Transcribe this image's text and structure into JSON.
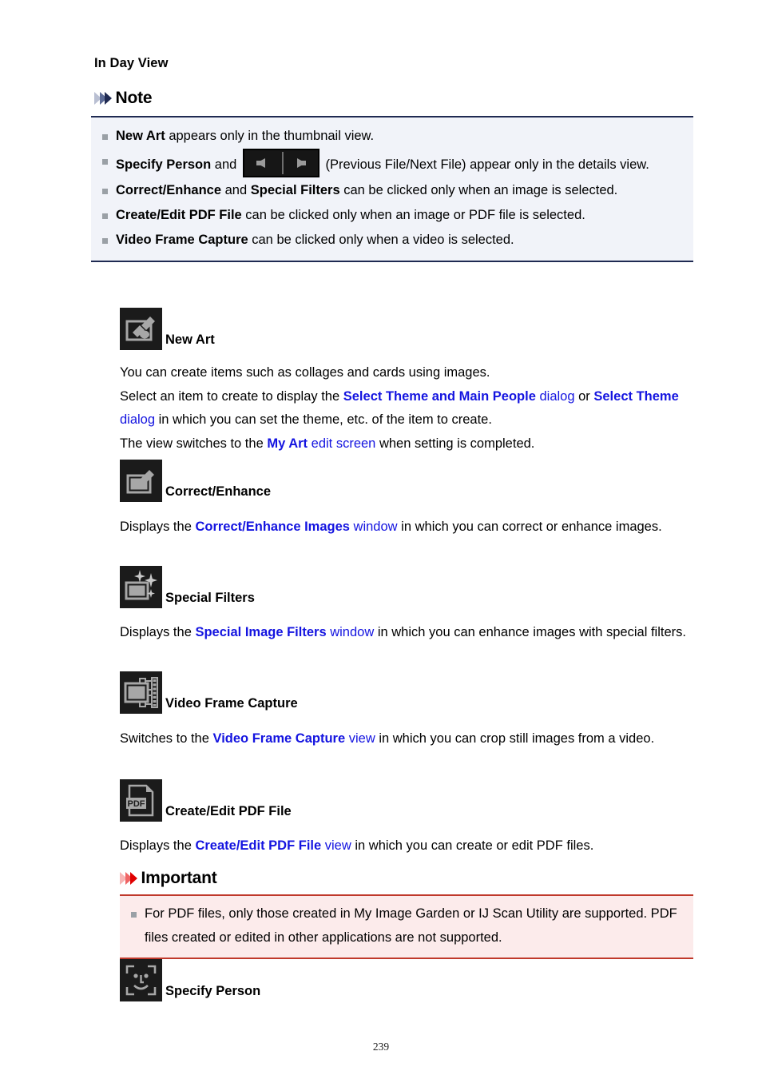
{
  "page": {
    "section_title": "In Day View",
    "page_number": "239"
  },
  "note": {
    "header_label": "Note",
    "accent_color": "#1f2a52",
    "background_color": "#f1f3f9",
    "bullets": [
      {
        "id": "new-art-note",
        "parts": [
          {
            "text": "New Art",
            "style": "bold"
          },
          {
            "text": " appears only in the thumbnail view.",
            "style": "normal"
          }
        ]
      },
      {
        "id": "specify-person-note",
        "parts": [
          {
            "text": "Specify Person",
            "style": "bold"
          },
          {
            "text": " and ",
            "style": "normal"
          },
          {
            "text": "",
            "style": "icon-prev-next"
          },
          {
            "text": " (Previous File/Next File) appear only in the details view.",
            "style": "normal"
          }
        ]
      },
      {
        "id": "correct-enhance-note",
        "parts": [
          {
            "text": "Correct/Enhance",
            "style": "bold"
          },
          {
            "text": " and ",
            "style": "normal"
          },
          {
            "text": "Special Filters",
            "style": "bold"
          },
          {
            "text": " can be clicked only when an image is selected.",
            "style": "normal"
          }
        ]
      },
      {
        "id": "create-edit-pdf-note",
        "parts": [
          {
            "text": "Create/Edit PDF File",
            "style": "bold"
          },
          {
            "text": " can be clicked only when an image or PDF file is selected.",
            "style": "normal"
          }
        ]
      },
      {
        "id": "video-frame-capture-note",
        "parts": [
          {
            "text": "Video Frame Capture",
            "style": "bold"
          },
          {
            "text": " can be clicked only when a video is selected.",
            "style": "normal"
          }
        ]
      }
    ]
  },
  "important": {
    "header_label": "Important",
    "accent_color": "#c0392b",
    "background_color": "#fcebeb",
    "bullets": [
      {
        "id": "pdf-support-note",
        "text": "For PDF files, only those created in My Image Garden or IJ Scan Utility are supported. PDF files created or edited in other applications are not supported."
      }
    ]
  },
  "entries": [
    {
      "id": "new-art",
      "icon": "new-art-icon",
      "caption": "New Art",
      "lines": [
        [
          {
            "t": "You can create items such as collages and cards using images.",
            "s": "normal"
          }
        ],
        [
          {
            "t": "Select an item to create to display the ",
            "s": "normal"
          },
          {
            "t": "Select Theme and Main People",
            "s": "link-bold"
          },
          {
            "t": " dialog",
            "s": "link"
          },
          {
            "t": " or ",
            "s": "normal"
          },
          {
            "t": "Select Theme",
            "s": "link-bold"
          },
          {
            "t": " dialog",
            "s": "link"
          },
          {
            "t": " in which you can set the theme, etc. of the item to create.",
            "s": "normal"
          }
        ],
        [
          {
            "t": "The view switches to the ",
            "s": "normal"
          },
          {
            "t": "My Art",
            "s": "link-bold"
          },
          {
            "t": " edit screen",
            "s": "link"
          },
          {
            "t": " when setting is completed.",
            "s": "normal"
          }
        ]
      ]
    },
    {
      "id": "correct-enhance",
      "icon": "correct-enhance-icon",
      "caption": "Correct/Enhance",
      "lines": [
        [
          {
            "t": "Displays the ",
            "s": "normal"
          },
          {
            "t": "Correct/Enhance Images",
            "s": "link-bold"
          },
          {
            "t": " window",
            "s": "link"
          },
          {
            "t": " in which you can correct or enhance images.",
            "s": "normal"
          }
        ]
      ]
    },
    {
      "id": "special-filters",
      "icon": "special-filters-icon",
      "caption": "Special Filters",
      "lines": [
        [
          {
            "t": "Displays the ",
            "s": "normal"
          },
          {
            "t": "Special Image Filters",
            "s": "link-bold"
          },
          {
            "t": " window",
            "s": "link"
          },
          {
            "t": " in which you can enhance images with special filters.",
            "s": "normal"
          }
        ]
      ]
    },
    {
      "id": "video-frame-capture",
      "icon": "video-frame-capture-icon",
      "caption": "Video Frame Capture",
      "lines": [
        [
          {
            "t": "Switches to the ",
            "s": "normal"
          },
          {
            "t": "Video Frame Capture",
            "s": "link-bold"
          },
          {
            "t": " view",
            "s": "link"
          },
          {
            "t": " in which you can crop still images from a video.",
            "s": "normal"
          }
        ]
      ]
    },
    {
      "id": "create-edit-pdf-file",
      "icon": "create-edit-pdf-icon",
      "caption": "Create/Edit PDF File",
      "lines": [
        [
          {
            "t": "Displays the ",
            "s": "normal"
          },
          {
            "t": "Create/Edit PDF File",
            "s": "link-bold"
          },
          {
            "t": " view",
            "s": "link"
          },
          {
            "t": " in which you can create or edit PDF files.",
            "s": "normal"
          }
        ]
      ]
    },
    {
      "id": "specify-person",
      "icon": "specify-person-icon",
      "caption": "Specify Person",
      "lines": []
    }
  ]
}
